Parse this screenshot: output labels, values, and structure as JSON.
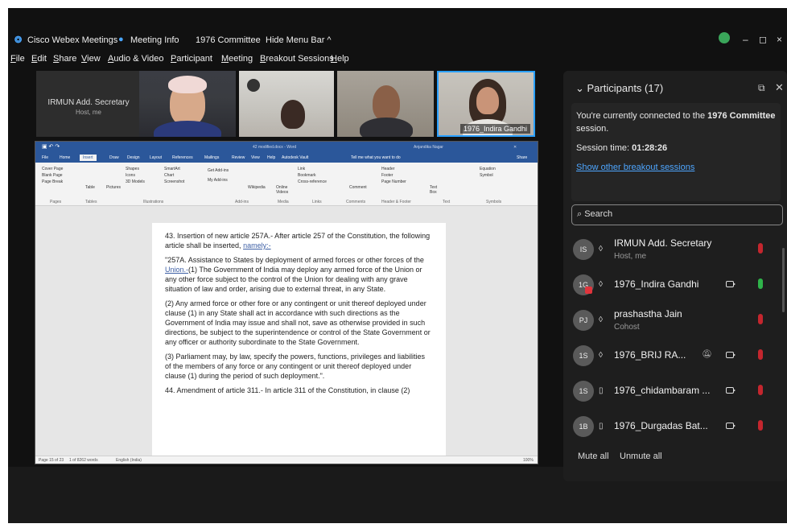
{
  "titlebar": {
    "app_title": "Cisco Webex Meetings",
    "meeting_info": "Meeting Info",
    "meeting_name": "1976 Committee",
    "hide_menu": "Hide Menu Bar ^",
    "minimize": "–",
    "restore": "◻",
    "close": "×"
  },
  "menu": [
    "File",
    "Edit",
    "Share",
    "View",
    "Audio & Video",
    "Participant",
    "Meeting",
    "Breakout Sessions",
    "Help"
  ],
  "videos": {
    "host_name": "IRMUN Add. Secretary",
    "host_sub": "Host, me",
    "active_label": "1976_Indira Gandhi"
  },
  "word": {
    "title": "42 modified.docx - Word",
    "user": "Anjandika Nagar",
    "tell_me": "Tell me what you want to do",
    "tabs": [
      "File",
      "Home",
      "Insert",
      "Draw",
      "Design",
      "Layout",
      "References",
      "Mailings",
      "Review",
      "View",
      "Help",
      "Autodesk Vault"
    ],
    "share": "Share",
    "ribbon_groups": [
      "Pages",
      "Tables",
      "Illustrations",
      "Add-ins",
      "Media",
      "Links",
      "Comments",
      "Header & Footer",
      "Text",
      "Symbols"
    ],
    "ribbon_items": {
      "pages": [
        "Cover Page",
        "Blank Page",
        "Page Break"
      ],
      "table": "Table",
      "pictures": "Pictures",
      "illus": [
        "Shapes",
        "Icons",
        "3D Models"
      ],
      "smart": [
        "SmartArt",
        "Chart",
        "Screenshot"
      ],
      "addins": [
        "Get Add-ins",
        "My Add-ins"
      ],
      "wikipedia": "Wikipedia",
      "video": "Online Videos",
      "links": [
        "Link",
        "Bookmark",
        "Cross-reference"
      ],
      "comment": "Comment",
      "hf": [
        "Header",
        "Footer",
        "Page Number"
      ],
      "textbox": "Text Box",
      "symbols": [
        "Equation",
        "Symbol"
      ]
    },
    "doc": {
      "p1_a": "43. Insertion of new article 257A.- After article 257 of the Constitution, the following article shall be inserted, ",
      "p1_link": "namely:-",
      "p2_a": "\"257A. Assistance to States by deployment of armed forces or other forces of the ",
      "p2_link": "Union.-",
      "p2_b": "(1) The Government of India may deploy any armed force of the Union or any other force subject to the control of the Union for dealing with any grave situation of law and order, arising due to external threat, in any State.",
      "p3": "(2) Any armed force or other fore or any contingent or unit thereof deployed under clause (1) in any State shall act in accordance with such directions as the Government of India may issue and shall not, save as otherwise provided in such directions, be subject to the superintendence or control of the State Government or any officer or authority subordinate to the State Government.",
      "p4": "(3) Parliament may, by law, specify the powers, functions, privileges and liabilities of the members of any force or any contingent or unit thereof deployed under clause (1) during the period of such deployment.\".",
      "p5": "44. Amendment of article 311.- In article 311 of the Constitution, in clause (2)"
    },
    "status": {
      "page": "Page 15 of 23",
      "words": "1 of 8262 words",
      "lang": "English (India)",
      "zoom": "100%"
    }
  },
  "panel": {
    "title": "Participants (17)",
    "connected_prefix": "You're currently connected to the ",
    "connected_session": "1976 Committee",
    "connected_suffix": " session.",
    "session_time_label": "Session time: ",
    "session_time": "01:28:26",
    "other_sessions": "Show other breakout sessions",
    "search_placeholder": "Search",
    "participants": [
      {
        "initials": "IS",
        "name": "IRMUN Add. Secretary",
        "sub": "Host, me",
        "mic": "muted"
      },
      {
        "initials": "1G",
        "name": "1976_Indira Gandhi",
        "sub": "",
        "mic": "on"
      },
      {
        "initials": "PJ",
        "name": "prashastha Jain",
        "sub": "Cohost",
        "mic": "muted"
      },
      {
        "initials": "1S",
        "name": "1976_BRIJ RA...",
        "sub": "",
        "mic": "muted"
      },
      {
        "initials": "1S",
        "name": "1976_chidambaram ...",
        "sub": "",
        "mic": "muted"
      },
      {
        "initials": "1B",
        "name": "1976_Durgadas Bat...",
        "sub": "",
        "mic": "muted"
      }
    ],
    "mute_all": "Mute all",
    "unmute_all": "Unmute all"
  },
  "colors": {
    "accent": "#2aa0ff",
    "link": "#4ea6ff",
    "mic_muted": "#c4262e",
    "mic_on": "#2fb34a",
    "word_blue": "#2b579a"
  }
}
